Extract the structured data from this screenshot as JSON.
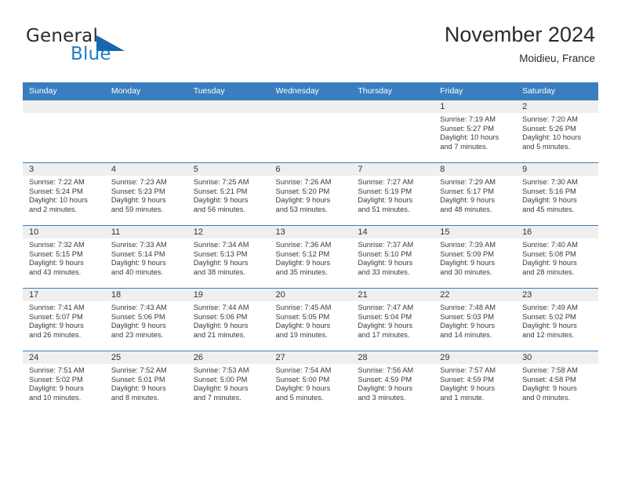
{
  "brand": {
    "general": "General",
    "blue": "Blue",
    "triangle_color": "#1767ab",
    "blue_color": "#1f7ec4"
  },
  "header": {
    "title": "November 2024",
    "location": "Moidieu, France"
  },
  "theme": {
    "header_band": "#3a7ebf",
    "daynum_band": "#efefef",
    "text": "#3a3a3a"
  },
  "weekdays": [
    "Sunday",
    "Monday",
    "Tuesday",
    "Wednesday",
    "Thursday",
    "Friday",
    "Saturday"
  ],
  "weeks": [
    [
      {
        "day": "",
        "empty": true,
        "sunrise": "",
        "sunset": "",
        "daylight1": "",
        "daylight2": ""
      },
      {
        "day": "",
        "empty": true,
        "sunrise": "",
        "sunset": "",
        "daylight1": "",
        "daylight2": ""
      },
      {
        "day": "",
        "empty": true,
        "sunrise": "",
        "sunset": "",
        "daylight1": "",
        "daylight2": ""
      },
      {
        "day": "",
        "empty": true,
        "sunrise": "",
        "sunset": "",
        "daylight1": "",
        "daylight2": ""
      },
      {
        "day": "",
        "empty": true,
        "sunrise": "",
        "sunset": "",
        "daylight1": "",
        "daylight2": ""
      },
      {
        "day": "1",
        "empty": false,
        "sunrise": "Sunrise: 7:19 AM",
        "sunset": "Sunset: 5:27 PM",
        "daylight1": "Daylight: 10 hours",
        "daylight2": "and 7 minutes."
      },
      {
        "day": "2",
        "empty": false,
        "sunrise": "Sunrise: 7:20 AM",
        "sunset": "Sunset: 5:26 PM",
        "daylight1": "Daylight: 10 hours",
        "daylight2": "and 5 minutes."
      }
    ],
    [
      {
        "day": "3",
        "empty": false,
        "sunrise": "Sunrise: 7:22 AM",
        "sunset": "Sunset: 5:24 PM",
        "daylight1": "Daylight: 10 hours",
        "daylight2": "and 2 minutes."
      },
      {
        "day": "4",
        "empty": false,
        "sunrise": "Sunrise: 7:23 AM",
        "sunset": "Sunset: 5:23 PM",
        "daylight1": "Daylight: 9 hours",
        "daylight2": "and 59 minutes."
      },
      {
        "day": "5",
        "empty": false,
        "sunrise": "Sunrise: 7:25 AM",
        "sunset": "Sunset: 5:21 PM",
        "daylight1": "Daylight: 9 hours",
        "daylight2": "and 56 minutes."
      },
      {
        "day": "6",
        "empty": false,
        "sunrise": "Sunrise: 7:26 AM",
        "sunset": "Sunset: 5:20 PM",
        "daylight1": "Daylight: 9 hours",
        "daylight2": "and 53 minutes."
      },
      {
        "day": "7",
        "empty": false,
        "sunrise": "Sunrise: 7:27 AM",
        "sunset": "Sunset: 5:19 PM",
        "daylight1": "Daylight: 9 hours",
        "daylight2": "and 51 minutes."
      },
      {
        "day": "8",
        "empty": false,
        "sunrise": "Sunrise: 7:29 AM",
        "sunset": "Sunset: 5:17 PM",
        "daylight1": "Daylight: 9 hours",
        "daylight2": "and 48 minutes."
      },
      {
        "day": "9",
        "empty": false,
        "sunrise": "Sunrise: 7:30 AM",
        "sunset": "Sunset: 5:16 PM",
        "daylight1": "Daylight: 9 hours",
        "daylight2": "and 45 minutes."
      }
    ],
    [
      {
        "day": "10",
        "empty": false,
        "sunrise": "Sunrise: 7:32 AM",
        "sunset": "Sunset: 5:15 PM",
        "daylight1": "Daylight: 9 hours",
        "daylight2": "and 43 minutes."
      },
      {
        "day": "11",
        "empty": false,
        "sunrise": "Sunrise: 7:33 AM",
        "sunset": "Sunset: 5:14 PM",
        "daylight1": "Daylight: 9 hours",
        "daylight2": "and 40 minutes."
      },
      {
        "day": "12",
        "empty": false,
        "sunrise": "Sunrise: 7:34 AM",
        "sunset": "Sunset: 5:13 PM",
        "daylight1": "Daylight: 9 hours",
        "daylight2": "and 38 minutes."
      },
      {
        "day": "13",
        "empty": false,
        "sunrise": "Sunrise: 7:36 AM",
        "sunset": "Sunset: 5:12 PM",
        "daylight1": "Daylight: 9 hours",
        "daylight2": "and 35 minutes."
      },
      {
        "day": "14",
        "empty": false,
        "sunrise": "Sunrise: 7:37 AM",
        "sunset": "Sunset: 5:10 PM",
        "daylight1": "Daylight: 9 hours",
        "daylight2": "and 33 minutes."
      },
      {
        "day": "15",
        "empty": false,
        "sunrise": "Sunrise: 7:39 AM",
        "sunset": "Sunset: 5:09 PM",
        "daylight1": "Daylight: 9 hours",
        "daylight2": "and 30 minutes."
      },
      {
        "day": "16",
        "empty": false,
        "sunrise": "Sunrise: 7:40 AM",
        "sunset": "Sunset: 5:08 PM",
        "daylight1": "Daylight: 9 hours",
        "daylight2": "and 28 minutes."
      }
    ],
    [
      {
        "day": "17",
        "empty": false,
        "sunrise": "Sunrise: 7:41 AM",
        "sunset": "Sunset: 5:07 PM",
        "daylight1": "Daylight: 9 hours",
        "daylight2": "and 26 minutes."
      },
      {
        "day": "18",
        "empty": false,
        "sunrise": "Sunrise: 7:43 AM",
        "sunset": "Sunset: 5:06 PM",
        "daylight1": "Daylight: 9 hours",
        "daylight2": "and 23 minutes."
      },
      {
        "day": "19",
        "empty": false,
        "sunrise": "Sunrise: 7:44 AM",
        "sunset": "Sunset: 5:06 PM",
        "daylight1": "Daylight: 9 hours",
        "daylight2": "and 21 minutes."
      },
      {
        "day": "20",
        "empty": false,
        "sunrise": "Sunrise: 7:45 AM",
        "sunset": "Sunset: 5:05 PM",
        "daylight1": "Daylight: 9 hours",
        "daylight2": "and 19 minutes."
      },
      {
        "day": "21",
        "empty": false,
        "sunrise": "Sunrise: 7:47 AM",
        "sunset": "Sunset: 5:04 PM",
        "daylight1": "Daylight: 9 hours",
        "daylight2": "and 17 minutes."
      },
      {
        "day": "22",
        "empty": false,
        "sunrise": "Sunrise: 7:48 AM",
        "sunset": "Sunset: 5:03 PM",
        "daylight1": "Daylight: 9 hours",
        "daylight2": "and 14 minutes."
      },
      {
        "day": "23",
        "empty": false,
        "sunrise": "Sunrise: 7:49 AM",
        "sunset": "Sunset: 5:02 PM",
        "daylight1": "Daylight: 9 hours",
        "daylight2": "and 12 minutes."
      }
    ],
    [
      {
        "day": "24",
        "empty": false,
        "sunrise": "Sunrise: 7:51 AM",
        "sunset": "Sunset: 5:02 PM",
        "daylight1": "Daylight: 9 hours",
        "daylight2": "and 10 minutes."
      },
      {
        "day": "25",
        "empty": false,
        "sunrise": "Sunrise: 7:52 AM",
        "sunset": "Sunset: 5:01 PM",
        "daylight1": "Daylight: 9 hours",
        "daylight2": "and 8 minutes."
      },
      {
        "day": "26",
        "empty": false,
        "sunrise": "Sunrise: 7:53 AM",
        "sunset": "Sunset: 5:00 PM",
        "daylight1": "Daylight: 9 hours",
        "daylight2": "and 7 minutes."
      },
      {
        "day": "27",
        "empty": false,
        "sunrise": "Sunrise: 7:54 AM",
        "sunset": "Sunset: 5:00 PM",
        "daylight1": "Daylight: 9 hours",
        "daylight2": "and 5 minutes."
      },
      {
        "day": "28",
        "empty": false,
        "sunrise": "Sunrise: 7:56 AM",
        "sunset": "Sunset: 4:59 PM",
        "daylight1": "Daylight: 9 hours",
        "daylight2": "and 3 minutes."
      },
      {
        "day": "29",
        "empty": false,
        "sunrise": "Sunrise: 7:57 AM",
        "sunset": "Sunset: 4:59 PM",
        "daylight1": "Daylight: 9 hours",
        "daylight2": "and 1 minute."
      },
      {
        "day": "30",
        "empty": false,
        "sunrise": "Sunrise: 7:58 AM",
        "sunset": "Sunset: 4:58 PM",
        "daylight1": "Daylight: 9 hours",
        "daylight2": "and 0 minutes."
      }
    ]
  ]
}
